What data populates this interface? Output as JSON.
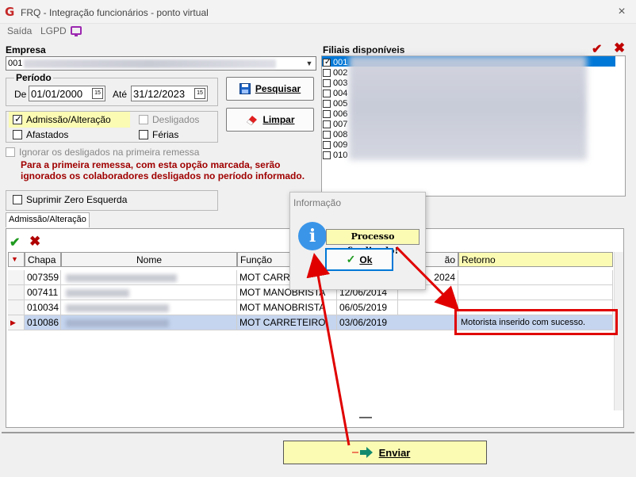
{
  "window": {
    "title": "FRQ - Integração funcionários - ponto virtual",
    "logo": "G",
    "close": "×"
  },
  "menu": {
    "saida": "Saída",
    "lgpd": "LGPD"
  },
  "empresa": {
    "label": "Empresa",
    "value": "001"
  },
  "periodo": {
    "label": "Período",
    "de_label": "De",
    "de_value": "01/01/2000",
    "ate_label": "Até",
    "ate_value": "31/12/2023",
    "cal_text": "15"
  },
  "buttons": {
    "pesquisar": "Pesquisar",
    "limpar": "Limpar",
    "enviar": "Enviar"
  },
  "options": {
    "admissao": "Admissão/Alteração",
    "desligados": "Desligados",
    "afastados": "Afastados",
    "ferias": "Férias",
    "ignorar": "Ignorar os desligados na primeira remessa",
    "suprimir": "Suprimir Zero Esquerda"
  },
  "warning": {
    "line1": "Para a primeira remessa, com esta opção marcada, serão",
    "line2": "ignorados os colaboradores desligados no período informado."
  },
  "filiais": {
    "label": "Filiais disponíveis",
    "items": [
      "001",
      "002",
      "003",
      "004",
      "005",
      "006",
      "007",
      "008",
      "009",
      "010"
    ]
  },
  "tab": {
    "label": "Admissão/Alteração"
  },
  "grid": {
    "headers": {
      "chapa": "Chapa",
      "nome": "Nome",
      "funcao": "Função",
      "admissao": "ão",
      "retorno": "Retorno"
    },
    "rows": [
      {
        "chapa": "007359",
        "funcao": "MOT CARRE",
        "admissao": "2024",
        "retorno": ""
      },
      {
        "chapa": "007411",
        "funcao": "MOT MANOBRISTA",
        "admissao": "12/06/2014",
        "retorno": ""
      },
      {
        "chapa": "010034",
        "funcao": "MOT MANOBRISTA",
        "admissao": "06/05/2019",
        "retorno": ""
      },
      {
        "chapa": "010086",
        "funcao": "MOT CARRETEIRO",
        "admissao": "03/06/2019",
        "retorno": "Motorista inserido com sucesso."
      }
    ]
  },
  "popup": {
    "title": "Informação",
    "icon": "i",
    "message": "Processo finalizado!",
    "ok": "Ok"
  },
  "colors": {
    "accent": "#0078d7",
    "highlight_yellow": "#fbfbb4",
    "annotation_red": "#e00000",
    "green_check": "#1f9a1f"
  }
}
